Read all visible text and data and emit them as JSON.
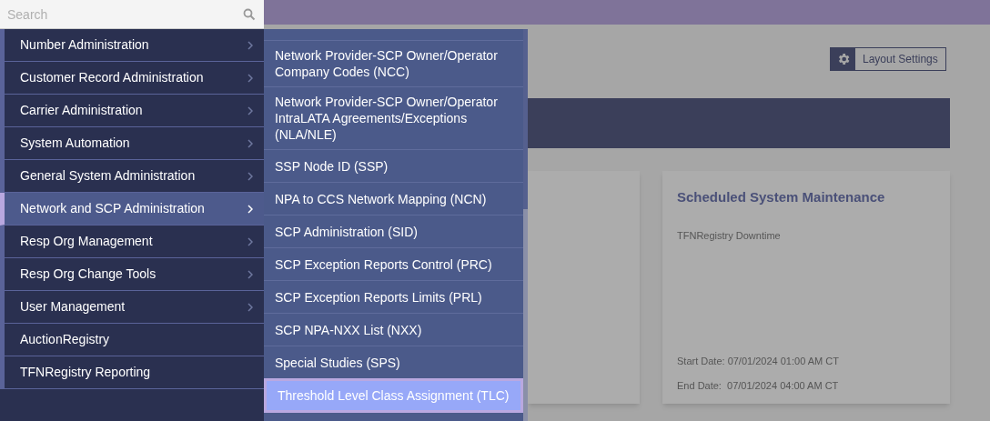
{
  "search": {
    "placeholder": "Search"
  },
  "menu": [
    {
      "label": "Number Administration",
      "has_submenu": true,
      "selected": false
    },
    {
      "label": "Customer Record Administration",
      "has_submenu": true,
      "selected": false
    },
    {
      "label": "Carrier Administration",
      "has_submenu": true,
      "selected": false
    },
    {
      "label": "System Automation",
      "has_submenu": true,
      "selected": false
    },
    {
      "label": "General System Administration",
      "has_submenu": true,
      "selected": false
    },
    {
      "label": "Network and SCP Administration",
      "has_submenu": true,
      "selected": true
    },
    {
      "label": "Resp Org Management",
      "has_submenu": true,
      "selected": false
    },
    {
      "label": "Resp Org Change Tools",
      "has_submenu": true,
      "selected": false
    },
    {
      "label": "User Management",
      "has_submenu": true,
      "selected": false
    },
    {
      "label": "AuctionRegistry",
      "has_submenu": false,
      "selected": false
    },
    {
      "label": "TFNRegistry Reporting",
      "has_submenu": false,
      "selected": false
    }
  ],
  "submenu": [
    {
      "label": "Network Provider-SCP Owner/Operator Company Codes (NCC)",
      "selected": false
    },
    {
      "label": "Network Provider-SCP Owner/Operator IntraLATA Agreements/Exceptions (NLA/NLE)",
      "selected": false
    },
    {
      "label": "SSP Node ID (SSP)",
      "selected": false
    },
    {
      "label": "NPA to CCS Network Mapping (NCN)",
      "selected": false
    },
    {
      "label": "SCP Administration (SID)",
      "selected": false
    },
    {
      "label": "SCP Exception Reports Control (PRC)",
      "selected": false
    },
    {
      "label": "SCP Exception Reports Limits (PRL)",
      "selected": false
    },
    {
      "label": "SCP NPA-NXX List (NXX)",
      "selected": false
    },
    {
      "label": "Special Studies (SPS)",
      "selected": false
    },
    {
      "label": "Threshold Level Class Assignment (TLC)",
      "selected": true
    }
  ],
  "layout_settings": {
    "label": "Layout Settings"
  },
  "maintenance_card": {
    "title": "Scheduled System Maintenance",
    "subtitle": "TFNRegistry Downtime",
    "start_date": "Start Date: 07/01/2024 01:00 AM CT",
    "end_date": "End Date:  07/01/2024 04:00 AM CT"
  }
}
